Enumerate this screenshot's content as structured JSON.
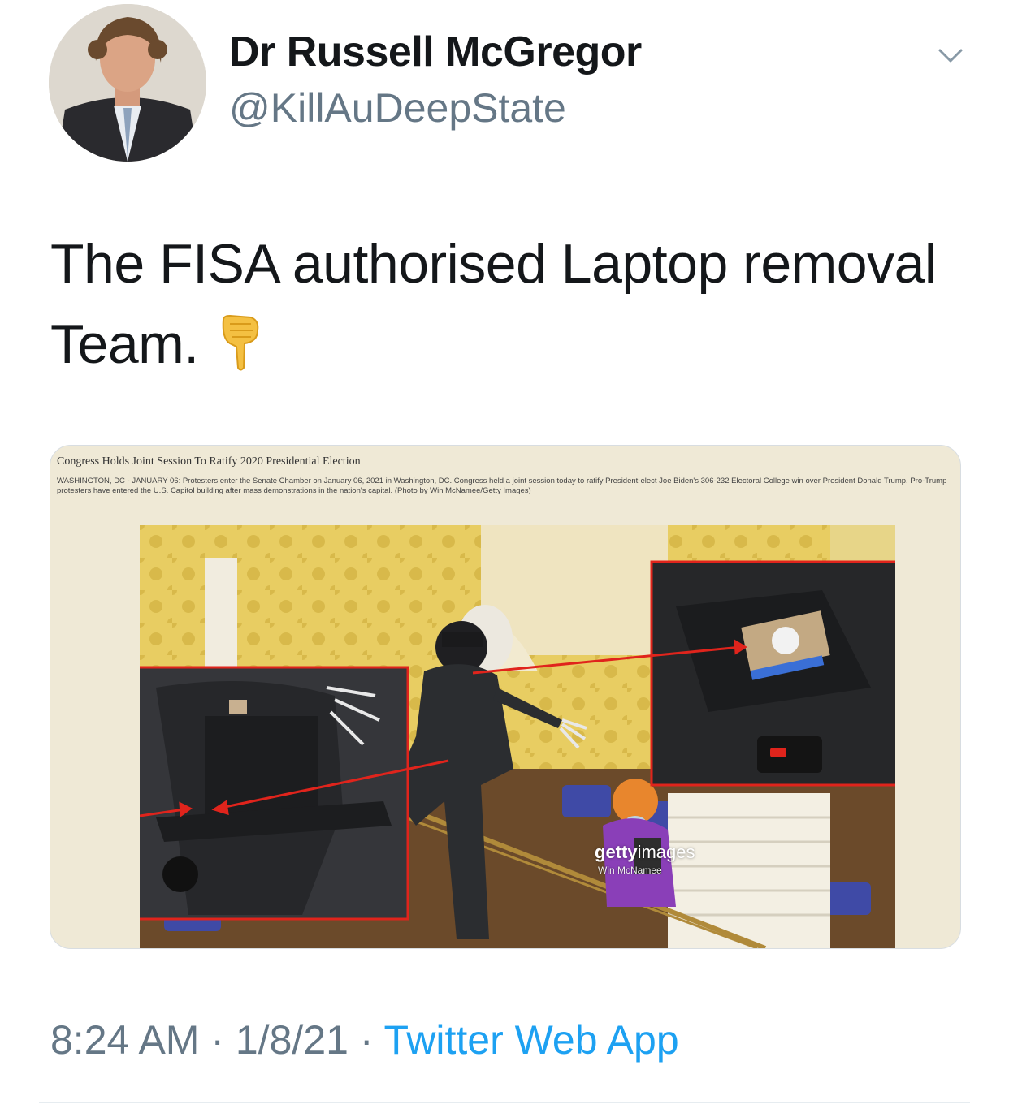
{
  "author": {
    "display_name": "Dr Russell McGregor",
    "handle": "@KillAuDeepState"
  },
  "tweet": {
    "text": "The FISA authorised Laptop removal Team."
  },
  "media": {
    "caption_title": "Congress Holds Joint Session To Ratify 2020 Presidential Election",
    "caption_body": "WASHINGTON, DC - JANUARY 06: Protesters enter the Senate Chamber on January 06, 2021 in Washington, DC. Congress held a joint session today to ratify President-elect Joe Biden's 306-232 Electoral College win over President Donald Trump. Pro-Trump protesters have entered the U.S. Capitol building after mass demonstrations in the nation's capital. (Photo by Win McNamee/Getty Images)",
    "watermark_brand": "getty",
    "watermark_brand_light": "images",
    "watermark_credit": "Win McNamee"
  },
  "meta": {
    "time": "8:24 AM",
    "date": "1/8/21",
    "separator": "·",
    "source": "Twitter Web App"
  },
  "icons": [
    "chevron-down-icon",
    "pointing-down-emoji"
  ],
  "colors": {
    "text": "#14171a",
    "secondary": "#657786",
    "link": "#1da1f2",
    "highlight_box": "#e0241c"
  }
}
